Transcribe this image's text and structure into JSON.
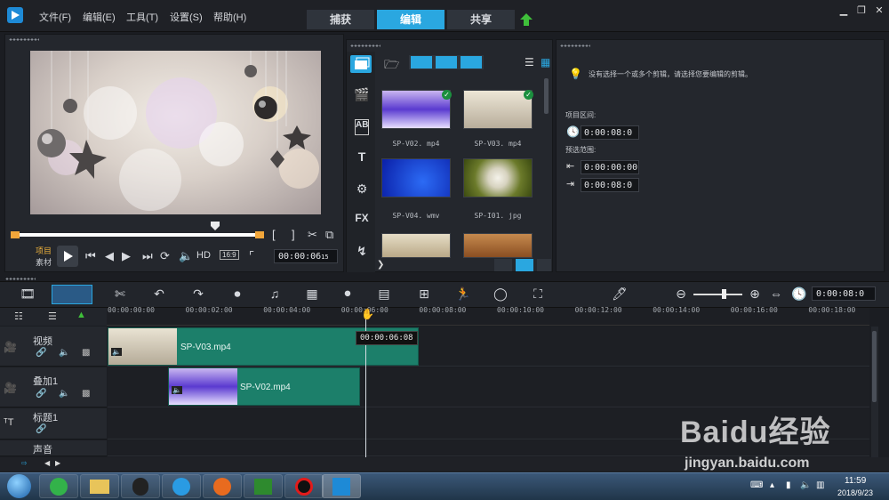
{
  "menu": {
    "items": [
      "文件(F)",
      "编辑(E)",
      "工具(T)",
      "设置(S)",
      "帮助(H)"
    ]
  },
  "modes": {
    "tabs": [
      "捕获",
      "编辑",
      "共享"
    ],
    "active": "编辑"
  },
  "player": {
    "project_label": "项目",
    "clip_label": "素材",
    "hd_label": "HD",
    "aspect_label": "16:9",
    "timecode": "00:00:06",
    "timecode_suffix": "15",
    "bracket_in": "[",
    "bracket_out": "]"
  },
  "library": {
    "items": [
      {
        "label": "SP-V02. mp4",
        "checked": true
      },
      {
        "label": "SP-V03. mp4",
        "checked": true
      },
      {
        "label": "SP-V04. wmv",
        "checked": false
      },
      {
        "label": "SP-I01. jpg",
        "checked": false
      }
    ],
    "fx_label": "FX",
    "ab_label": "AB",
    "t_label": "T"
  },
  "options": {
    "hint": "没有选择一个或多个剪辑，请选择您要编辑的剪辑。",
    "project_range_label": "项目区间:",
    "project_duration": "0:00:08:0",
    "preview_range_label": "预选范围:",
    "range_start": "0:00:00:00",
    "range_end": "0:00:08:0"
  },
  "timeline": {
    "total_timecode": "0:00:08:0",
    "playhead_tooltip": "00:00:06:08",
    "ruler": [
      "00:00:00:00",
      "00:00:02:00",
      "00:00:04:00",
      "00:00:06:00",
      "00:00:08:00",
      "00:00:10:00",
      "00:00:12:00",
      "00:00:14:00",
      "00:00:16:00",
      "00:00:18:00"
    ],
    "tracks": [
      {
        "name": "视频"
      },
      {
        "name": "叠加1"
      },
      {
        "name": "标题1"
      },
      {
        "name": "声音"
      }
    ],
    "clips": {
      "video": "SP-V03.mp4",
      "overlay": "SP-V02.mp4"
    }
  },
  "taskbar": {
    "time": "11:59",
    "date": "2018/9/23"
  },
  "watermark": {
    "brand": "Baidu经验",
    "url": "jingyan.baidu.com"
  },
  "colors": {
    "accent": "#2aa7e0",
    "clip": "#1c7f6a",
    "trim": "#f1a63a"
  }
}
